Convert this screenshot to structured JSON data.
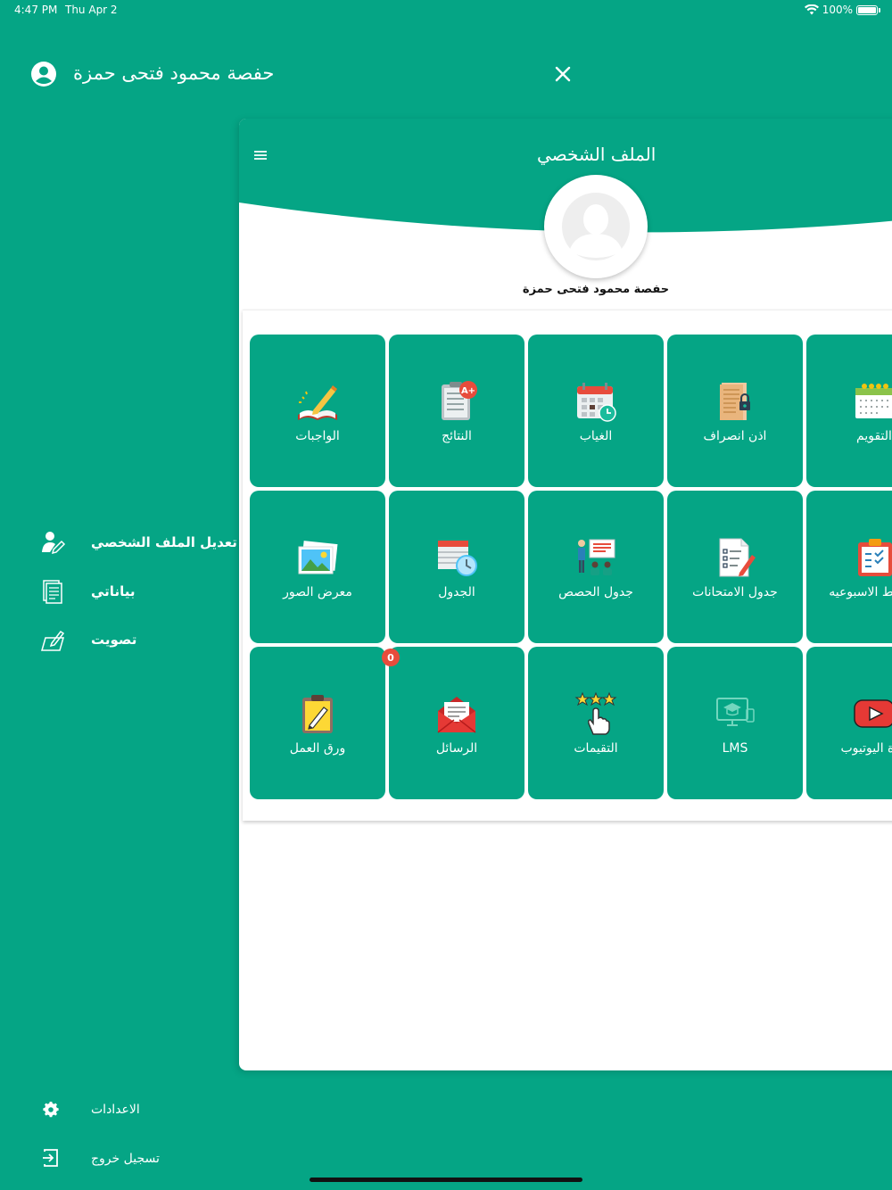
{
  "status": {
    "time": "4:47 PM",
    "date": "Thu Apr 2",
    "battery": "100%"
  },
  "drawer": {
    "user_name": "حفصة محمود فتحى حمزة",
    "menu": [
      {
        "label": "تعديل الملف الشخصي",
        "icon": "edit-profile-icon"
      },
      {
        "label": "بياناتي",
        "icon": "my-data-icon"
      },
      {
        "label": "تصويت",
        "icon": "vote-icon"
      }
    ],
    "bottom": [
      {
        "label": "الاعدادات",
        "icon": "gear-icon"
      },
      {
        "label": "تسجيل خروج",
        "icon": "logout-icon"
      }
    ]
  },
  "card": {
    "title": "الملف الشخصي",
    "profile_name": "حفصة محمود فتحى حمزة",
    "tiles": [
      {
        "label": "الواجبات",
        "icon": "homework-icon"
      },
      {
        "label": "النتائج",
        "icon": "results-icon"
      },
      {
        "label": "الغياب",
        "icon": "absence-calendar-icon"
      },
      {
        "label": "اذن انصراف",
        "icon": "leave-permit-icon"
      },
      {
        "label": "التقويم",
        "icon": "calendar-icon"
      },
      {
        "label": "معرض الصور",
        "icon": "gallery-icon"
      },
      {
        "label": "الجدول",
        "icon": "schedule-icon"
      },
      {
        "label": "جدول الحصص",
        "icon": "classes-icon"
      },
      {
        "label": "جدول الامتحانات",
        "icon": "exams-icon"
      },
      {
        "label": "الخطط الاسبوعيه",
        "icon": "weekly-plan-icon"
      },
      {
        "label": "ورق العمل",
        "icon": "worksheet-icon"
      },
      {
        "label": "الرسائل",
        "icon": "messages-icon",
        "badge": "0"
      },
      {
        "label": "التقيمات",
        "icon": "ratings-icon"
      },
      {
        "label": "LMS",
        "icon": "lms-icon"
      },
      {
        "label": "قناة اليوتيوب",
        "icon": "youtube-icon"
      }
    ]
  },
  "colors": {
    "primary": "#05a585",
    "badge": "#e74c3c",
    "card": "#ffffff"
  }
}
